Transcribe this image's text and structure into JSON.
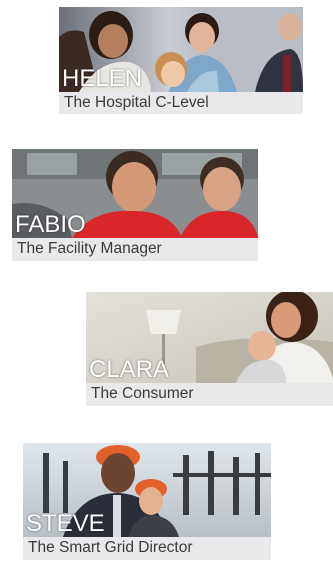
{
  "personas": [
    {
      "name": "HELEN",
      "title": "The Hospital C-Level"
    },
    {
      "name": "FABIO",
      "title": "The Facility Manager"
    },
    {
      "name": "CLARA",
      "title": "The Consumer"
    },
    {
      "name": "STEVE",
      "title": "The Smart Grid Director"
    }
  ],
  "colors": {
    "caption_background": "#e9e9eb",
    "caption_text": "#3a3a3a",
    "name_text": "#ffffff",
    "fabio_shirt": "#d9262b",
    "steve_helmet": "#e2602a"
  },
  "icons": {
    "helen": "hospital-staff-photo",
    "fabio": "facility-managers-photo",
    "clara": "mother-with-baby-photo",
    "steve": "grid-director-photo"
  }
}
